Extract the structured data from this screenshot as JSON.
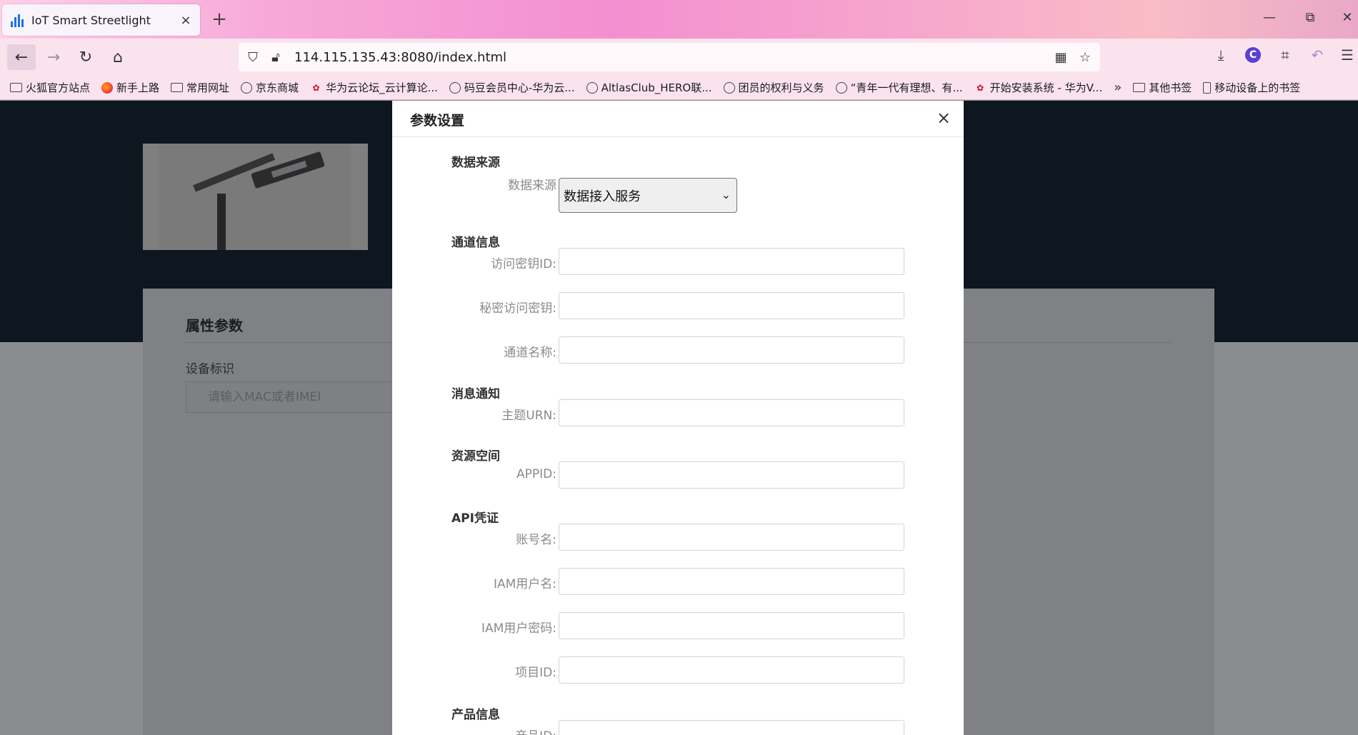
{
  "browser": {
    "tab_title": "IoT Smart Streetlight",
    "tab_close": "×",
    "new_tab": "+",
    "url": "114.115.135.43:8080/index.html",
    "win_min": "—",
    "win_restore": "⧉",
    "win_close": "✕",
    "bookmarks": [
      {
        "label": "火狐官方站点",
        "icon": "folder"
      },
      {
        "label": "新手上路",
        "icon": "firefox"
      },
      {
        "label": "常用网址",
        "icon": "folder"
      },
      {
        "label": "京东商城",
        "icon": "globe"
      },
      {
        "label": "华为云论坛_云计算论...",
        "icon": "huawei"
      },
      {
        "label": "码豆会员中心-华为云...",
        "icon": "globe"
      },
      {
        "label": "AltlasClub_HERO联...",
        "icon": "globe"
      },
      {
        "label": "团员的权利与义务",
        "icon": "globe"
      },
      {
        "label": "“青年一代有理想、有...",
        "icon": "globe"
      },
      {
        "label": "开始安装系统 - 华为V...",
        "icon": "huawei"
      }
    ],
    "bookmarks_more": "»",
    "other_bookmarks": "其他书签",
    "mobile_bookmarks": "移动设备上的书签"
  },
  "page": {
    "card_title": "属性参数",
    "device_label": "设备标识",
    "device_placeholder": "请输入MAC或者IMEI"
  },
  "modal": {
    "title": "参数设置",
    "close": "×",
    "data_source": {
      "section": "数据来源",
      "label": "数据来源",
      "selected": "数据接入服务"
    },
    "channel": {
      "section": "通道信息",
      "access_key_label": "访问密钥ID:",
      "secret_key_label": "秘密访问密钥:",
      "channel_name_label": "通道名称:"
    },
    "notification": {
      "section": "消息通知",
      "topic_label": "主题URN:"
    },
    "resource": {
      "section": "资源空间",
      "appid_label": "APPID:"
    },
    "api": {
      "section": "API凭证",
      "account_label": "账号名:",
      "iam_user_label": "IAM用户名:",
      "iam_password_label": "IAM用户密码:",
      "project_label": "项目ID:"
    },
    "product": {
      "section": "产品信息",
      "product_label": "产品ID:"
    }
  }
}
